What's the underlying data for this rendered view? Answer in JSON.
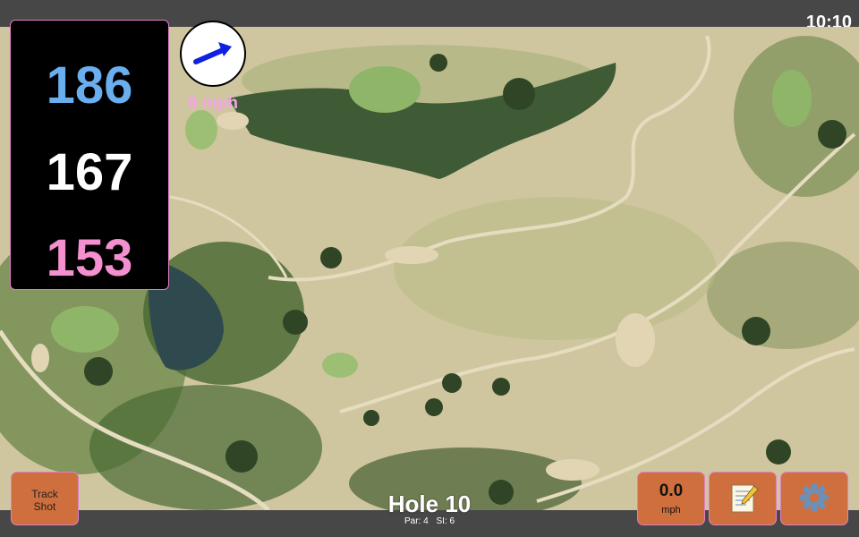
{
  "status": {
    "time": "10:10"
  },
  "distances": {
    "back": "186",
    "middle": "167",
    "front": "153"
  },
  "wind": {
    "speed_label": "8 mph",
    "direction": "east-north-east",
    "icon": "wind-arrow-icon"
  },
  "buttons": {
    "track_shot_line1": "Track",
    "track_shot_line2": "Shot",
    "wind_value": "0.0",
    "wind_unit": "mph",
    "notes_icon": "notepad-icon",
    "settings_icon": "gear-icon"
  },
  "hole": {
    "title": "Hole 10",
    "par": "Par: 4",
    "si": "SI: 6"
  },
  "colors": {
    "back": "#6aaeee",
    "middle": "#ffffff",
    "front": "#f490cf",
    "button": "#cf6f3d",
    "accent": "#e080c8"
  }
}
